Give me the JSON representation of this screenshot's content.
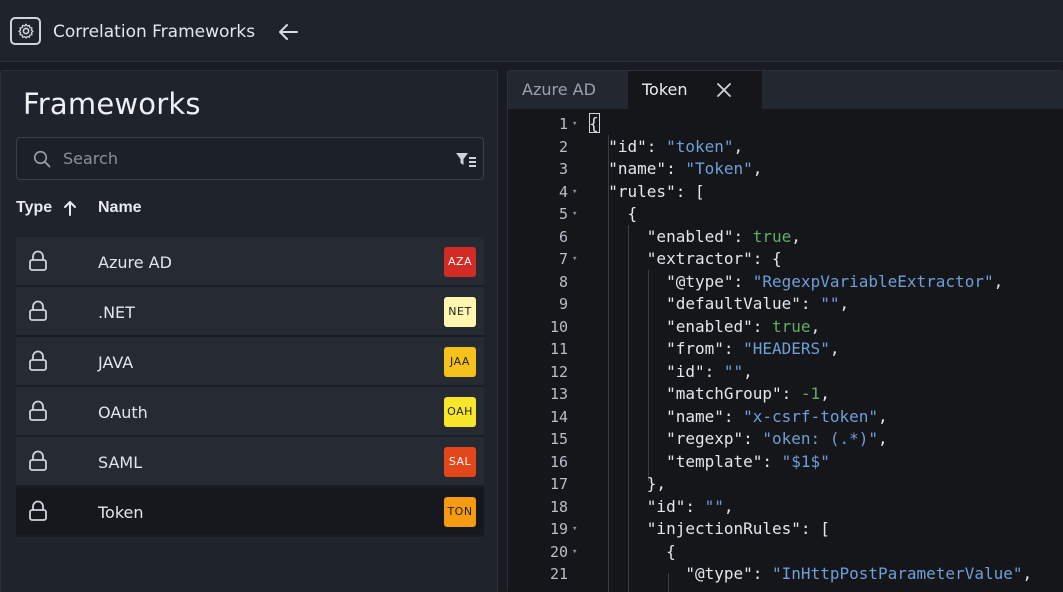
{
  "header": {
    "title": "Correlation Frameworks"
  },
  "frameworks": {
    "title": "Frameworks",
    "search": {
      "placeholder": "Search",
      "value": ""
    },
    "columns": {
      "type": "Type",
      "name": "Name"
    },
    "items": [
      {
        "name": "Azure AD",
        "badge": "AZA",
        "badge_bg": "#d22a25",
        "badge_fg": "#ffffff"
      },
      {
        "name": ".NET",
        "badge": "NET",
        "badge_bg": "#fff7b0",
        "badge_fg": "#222222"
      },
      {
        "name": "JAVA",
        "badge": "JAA",
        "badge_bg": "#f5c21b",
        "badge_fg": "#222222"
      },
      {
        "name": "OAuth",
        "badge": "OAH",
        "badge_bg": "#f7e62a",
        "badge_fg": "#222222"
      },
      {
        "name": "SAML",
        "badge": "SAL",
        "badge_bg": "#e4461c",
        "badge_fg": "#ffffff"
      },
      {
        "name": "Token",
        "badge": "TON",
        "badge_bg": "#f49b12",
        "badge_fg": "#222222"
      }
    ],
    "selected_index": 5
  },
  "editor": {
    "tabs": [
      {
        "label": "Azure AD"
      },
      {
        "label": "Token"
      }
    ],
    "active_tab": 1,
    "line_numbers": [
      "1",
      "2",
      "3",
      "4",
      "5",
      "6",
      "7",
      "8",
      "9",
      "10",
      "11",
      "12",
      "13",
      "14",
      "15",
      "16",
      "17",
      "18",
      "19",
      "20",
      "21"
    ],
    "lines": [
      [
        [
          "k",
          "{"
        ]
      ],
      [
        [
          "k",
          "  \"id\": "
        ],
        [
          "s",
          "\"token\""
        ],
        [
          "k",
          ","
        ]
      ],
      [
        [
          "k",
          "  \"name\": "
        ],
        [
          "s",
          "\"Token\""
        ],
        [
          "k",
          ","
        ]
      ],
      [
        [
          "k",
          "  \"rules\": ["
        ]
      ],
      [
        [
          "k",
          "    {"
        ]
      ],
      [
        [
          "k",
          "      \"enabled\": "
        ],
        [
          "b",
          "true"
        ],
        [
          "k",
          ","
        ]
      ],
      [
        [
          "k",
          "      \"extractor\": {"
        ]
      ],
      [
        [
          "k",
          "        \"@type\": "
        ],
        [
          "s",
          "\"RegexpVariableExtractor\""
        ],
        [
          "k",
          ","
        ]
      ],
      [
        [
          "k",
          "        \"defaultValue\": "
        ],
        [
          "s",
          "\"\""
        ],
        [
          "k",
          ","
        ]
      ],
      [
        [
          "k",
          "        \"enabled\": "
        ],
        [
          "b",
          "true"
        ],
        [
          "k",
          ","
        ]
      ],
      [
        [
          "k",
          "        \"from\": "
        ],
        [
          "s",
          "\"HEADERS\""
        ],
        [
          "k",
          ","
        ]
      ],
      [
        [
          "k",
          "        \"id\": "
        ],
        [
          "s",
          "\"\""
        ],
        [
          "k",
          ","
        ]
      ],
      [
        [
          "k",
          "        \"matchGroup\": "
        ],
        [
          "n",
          "-1"
        ],
        [
          "k",
          ","
        ]
      ],
      [
        [
          "k",
          "        \"name\": "
        ],
        [
          "s",
          "\"x-csrf-token\""
        ],
        [
          "k",
          ","
        ]
      ],
      [
        [
          "k",
          "        \"regexp\": "
        ],
        [
          "s",
          "\"oken: (.*)\""
        ],
        [
          "k",
          ","
        ]
      ],
      [
        [
          "k",
          "        \"template\": "
        ],
        [
          "s",
          "\"$1$\""
        ]
      ],
      [
        [
          "k",
          "      },"
        ]
      ],
      [
        [
          "k",
          "      \"id\": "
        ],
        [
          "s",
          "\"\""
        ],
        [
          "k",
          ","
        ]
      ],
      [
        [
          "k",
          "      \"injectionRules\": ["
        ]
      ],
      [
        [
          "k",
          "        {"
        ]
      ],
      [
        [
          "k",
          "          \"@type\": "
        ],
        [
          "s",
          "\"InHttpPostParameterValue\""
        ],
        [
          "k",
          ","
        ]
      ]
    ],
    "foldable_lines": [
      1,
      4,
      5,
      7,
      19,
      20
    ]
  },
  "colors": {
    "accent_selected_row": "#16181d",
    "string": "#6e9fd8",
    "literal": "#5fae6a"
  }
}
